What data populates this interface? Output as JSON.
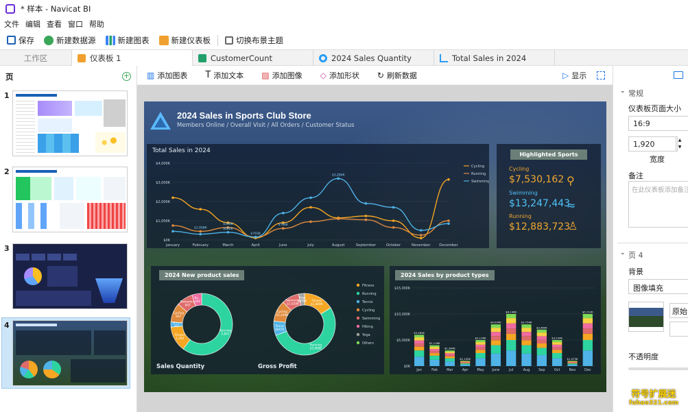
{
  "window": {
    "title": "* 样本 - Navicat BI"
  },
  "menu": [
    "文件",
    "编辑",
    "查看",
    "窗口",
    "帮助"
  ],
  "toolbar": {
    "save": "保存",
    "new_datasource": "新建数据源",
    "new_chart": "新建图表",
    "new_dashboard": "新建仪表板",
    "switch_theme": "切换布景主题"
  },
  "tabs": [
    "工作区",
    "仪表板 1",
    "CustomerCount",
    "2024 Sales Quantity",
    "Total Sales in 2024"
  ],
  "left": {
    "title": "页",
    "pages": [
      "1",
      "2",
      "3",
      "4"
    ]
  },
  "editor_toolbar": {
    "add_chart": "添加图表",
    "add_text": "添加文本",
    "add_image": "添加图像",
    "add_shape": "添加形状",
    "refresh": "刷新数据",
    "display": "显示"
  },
  "dashboard": {
    "title": "2024 Sales in Sports Club Store",
    "subtitle": "Members Online / Overall Visit / All Orders / Customer Status",
    "line_chart": {
      "title": "Total Sales in 2024"
    },
    "highlight": {
      "title": "Highlighted Sports",
      "items": [
        {
          "name": "Cycling",
          "value": "$7,530,162"
        },
        {
          "name": "Swimming",
          "value": "$13,247,443"
        },
        {
          "name": "Running",
          "value": "$12,883,723"
        }
      ]
    },
    "donut": {
      "title": "2024 New product sales",
      "left_label": "Sales Quantity",
      "right_label": "Gross Profit"
    },
    "stack": {
      "title": "2024 Sales by product types"
    }
  },
  "chart_data": [
    {
      "type": "line",
      "title": "Total Sales in 2024",
      "categories": [
        "January",
        "February",
        "March",
        "April",
        "June",
        "July",
        "August",
        "September",
        "October",
        "November",
        "December"
      ],
      "y_ticks": [
        "$0K",
        "$1,000K",
        "$2,000K",
        "$3,000K",
        "$4,000K"
      ],
      "ylim": [
        0,
        4000000
      ],
      "series": [
        {
          "name": "Cycling",
          "values": [
            2200000,
            1600000,
            900000,
            100000,
            900000,
            1700000,
            1150000,
            1250000,
            1000000,
            100000,
            3150000
          ]
        },
        {
          "name": "Running",
          "values": [
            750000,
            450000,
            650000,
            150000,
            600000,
            950000,
            1100000,
            1050000,
            650000,
            250000,
            1000000
          ]
        },
        {
          "name": "Swimming",
          "values": [
            450000,
            300000,
            400000,
            150000,
            1400000,
            2200000,
            3200000,
            1900000,
            1700000,
            500000,
            850000
          ]
        }
      ],
      "point_labels": [
        "$3,284K",
        "$1,008K",
        "$396K",
        "$793K",
        "$766K",
        "$680K"
      ]
    },
    {
      "type": "pie",
      "title": "Sales Quantity",
      "legend": [
        "Fitness",
        "Running",
        "Tennis",
        "Cycling",
        "Swimming",
        "Hiking",
        "Yoga",
        "Others"
      ],
      "labels": [
        "Running 5,847",
        "Fitness 1,294",
        "Tennis 267",
        "Cycling 967",
        "Swimming 847",
        "Ba... 490"
      ],
      "values": [
        5847,
        1294,
        267,
        967,
        847,
        490
      ]
    },
    {
      "type": "pie",
      "title": "Gross Profit",
      "labels": [
        "Fitness $1,809K",
        "Running $5,960K",
        "Tennis $847K",
        "Cycling $1,249K",
        "Swimming $1,028K",
        "Yoga $349K"
      ],
      "values": [
        1809,
        5960,
        847,
        1249,
        1028,
        349
      ]
    },
    {
      "type": "bar",
      "title": "2024 Sales by product types",
      "categories": [
        "Jan",
        "Feb",
        "Mar",
        "Apr",
        "May",
        "June",
        "Jul",
        "Aug",
        "Sep",
        "Oct",
        "Nov",
        "Dec"
      ],
      "y_ticks": [
        "$0K",
        "$5,000K",
        "$10,000K",
        "$15,000K"
      ],
      "ylim": [
        0,
        15000000
      ],
      "values": [
        6000000,
        4000000,
        3000000,
        1000000,
        5000000,
        8000000,
        10000000,
        8000000,
        7000000,
        5000000,
        1000000,
        10000000
      ],
      "top_labels": [
        "$3,484K",
        "$2,116K",
        "$1,384K",
        "$1,152K",
        "$2,116K",
        "$4,034K",
        "$6,146K",
        "$3,754K",
        "$3,464K",
        "$3,234K",
        "$1,073K",
        "$5,714K"
      ]
    }
  ],
  "right": {
    "section_general": "常规",
    "page_size_label": "仪表板页面大小",
    "page_size": "16:9",
    "width_value": "1,920",
    "width_label": "宽度",
    "note_label": "备注",
    "note_placeholder": "在此仪表板添加备注",
    "page_section": "页 4",
    "bg_label": "背景",
    "bg_value": "图像填充",
    "original_btn": "原始",
    "opacity_label": "不透明度"
  },
  "watermark": {
    "line1": "符号扩展迷",
    "line2": "fuhao321.com"
  },
  "colors": {
    "accent": "#1a73e8",
    "dash_bg": "#2f4d4a",
    "cycling": "#f5a623",
    "running": "#e08a3c",
    "swimming": "#4fb3e8"
  }
}
